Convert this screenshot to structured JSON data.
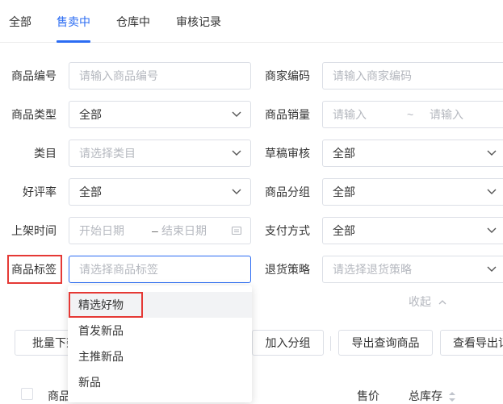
{
  "tabs": [
    {
      "label": "全部",
      "active": false
    },
    {
      "label": "售卖中",
      "active": true
    },
    {
      "label": "仓库中",
      "active": false
    },
    {
      "label": "审核记录",
      "active": false
    }
  ],
  "filters": {
    "product_code": {
      "label": "商品编号",
      "placeholder": "请输入商品编号"
    },
    "merchant_code": {
      "label": "商家编码",
      "placeholder": "请输入商家编码"
    },
    "product_type": {
      "label": "商品类型",
      "value": "全部"
    },
    "sales_volume": {
      "label": "商品销量",
      "min_placeholder": "请输入",
      "separator": "~",
      "max_placeholder": "请输入"
    },
    "category": {
      "label": "类目",
      "placeholder": "请选择类目"
    },
    "draft_review": {
      "label": "草稿审核",
      "value": "全部"
    },
    "rating": {
      "label": "好评率",
      "value": "全部"
    },
    "product_group": {
      "label": "商品分组",
      "value": "全部"
    },
    "listing_time": {
      "label": "上架时间",
      "start_placeholder": "开始日期",
      "separator": "–",
      "end_placeholder": "结束日期"
    },
    "payment_method": {
      "label": "支付方式",
      "value": "全部"
    },
    "product_tag": {
      "label": "商品标签",
      "placeholder": "请选择商品标签"
    },
    "return_policy": {
      "label": "退货策略",
      "placeholder": "请选择退货策略"
    }
  },
  "tag_dropdown": {
    "options": [
      "精选好物",
      "首发新品",
      "主推新品",
      "新品"
    ],
    "hovered": "精选好物"
  },
  "collapse_label": "收起",
  "actions": {
    "batch_listing": "批量下架",
    "add_group": "加入分组",
    "export_query": "导出查询商品",
    "view_export": "查看导出记录"
  },
  "table": {
    "headers": [
      "商品",
      "售价",
      "总库存"
    ]
  },
  "colors": {
    "accent": "#2b6cf3",
    "highlight": "#e53935",
    "placeholder": "#b5b8bf",
    "border": "#dcdfe6"
  }
}
